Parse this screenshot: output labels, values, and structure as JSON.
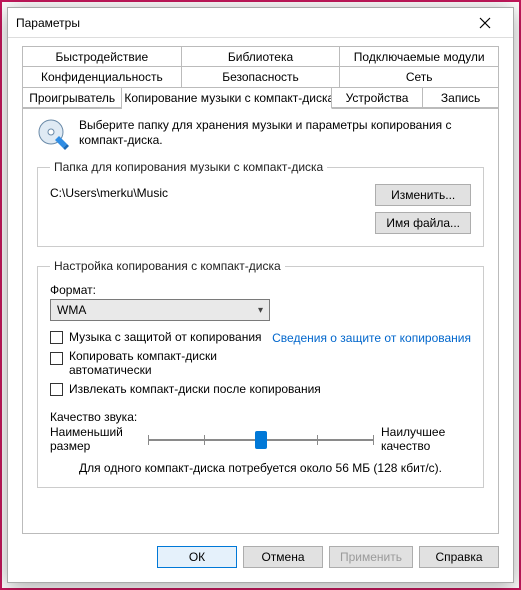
{
  "window": {
    "title": "Параметры"
  },
  "tabs": {
    "row1": [
      "Быстродействие",
      "Библиотека",
      "Подключаемые модули"
    ],
    "row2": [
      "Конфиденциальность",
      "Безопасность",
      "Сеть"
    ],
    "row3": [
      "Проигрыватель",
      "Копирование музыки с компакт-диска",
      "Устройства",
      "Запись"
    ],
    "active": "Копирование музыки с компакт-диска"
  },
  "intro": "Выберите папку для хранения музыки и параметры копирования с компакт-диска.",
  "folder_group": {
    "legend": "Папка для копирования музыки с компакт-диска",
    "path": "C:\\Users\\merku\\Music",
    "change_btn": "Изменить...",
    "filename_btn": "Имя файла..."
  },
  "rip_group": {
    "legend": "Настройка копирования с компакт-диска",
    "format_label": "Формат:",
    "format_value": "WMA",
    "copy_protect_label": "Музыка с защитой от копирования",
    "copy_protect_link": "Сведения о защите от копирования",
    "auto_rip_label": "Копировать компакт-диски автоматически",
    "eject_label": "Извлекать компакт-диски после копирования",
    "quality_label": "Качество звука:",
    "min_label": "Наименьший размер",
    "max_label": "Наилучшее качество",
    "estimate": "Для одного компакт-диска потребуется около 56 МБ (128 кбит/с).",
    "slider_pos_pct": 50
  },
  "footer": {
    "ok": "ОК",
    "cancel": "Отмена",
    "apply": "Применить",
    "help": "Справка"
  }
}
